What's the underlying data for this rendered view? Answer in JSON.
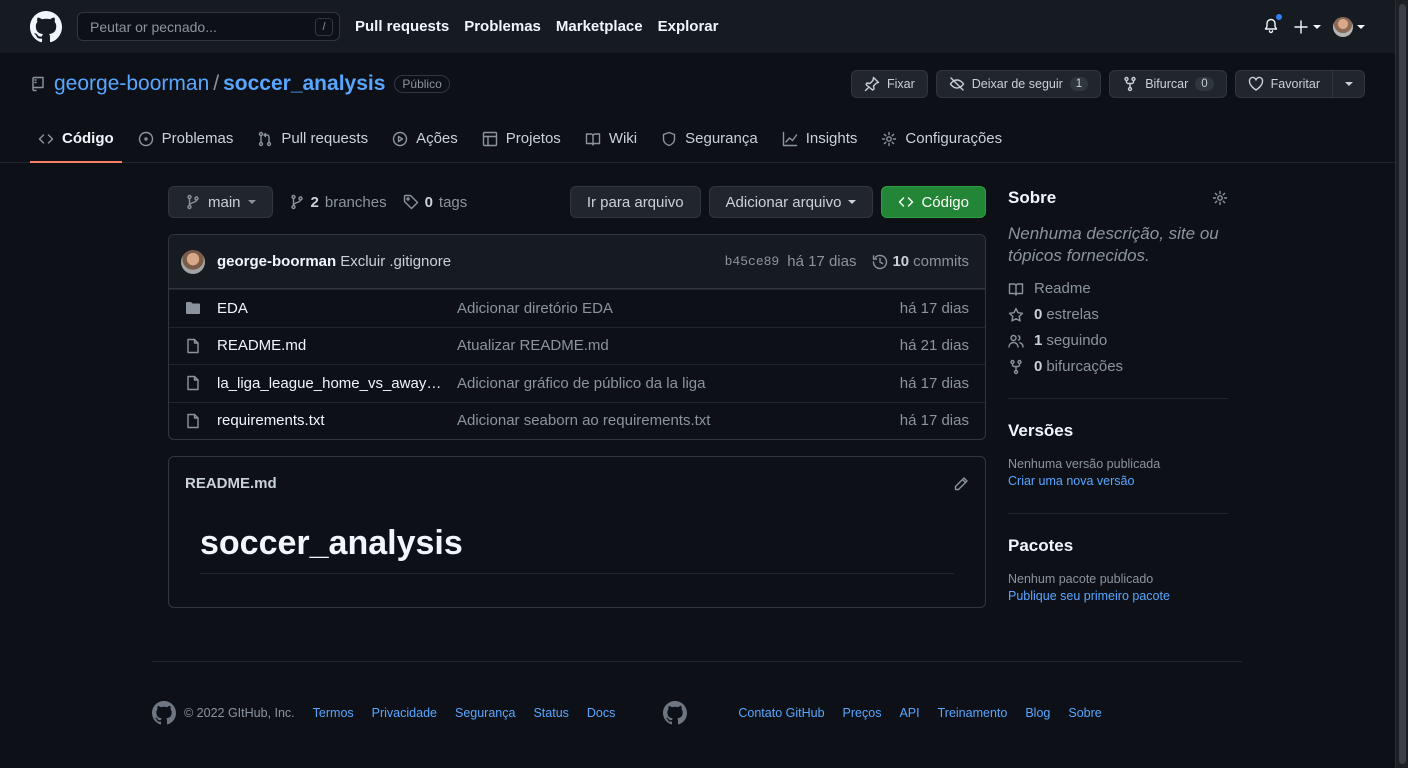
{
  "header": {
    "search_placeholder": "Peutar or pecnado...",
    "search_shortcut": "/",
    "nav": [
      "Pull requests",
      "Problemas",
      "Marketplace",
      "Explorar"
    ]
  },
  "repo": {
    "owner": "george-boorman",
    "separator": "/",
    "name": "soccer_analysis",
    "visibility": "Público",
    "actions": {
      "pin": "Fixar",
      "unwatch": "Deixar de seguir",
      "unwatch_count": "1",
      "fork": "Bifurcar",
      "fork_count": "0",
      "star": "Favoritar"
    }
  },
  "tabs": [
    "Código",
    "Problemas",
    "Pull requests",
    "Ações",
    "Projetos",
    "Wiki",
    "Segurança",
    "Insights",
    "Configurações"
  ],
  "toolbar": {
    "branch": "main",
    "branches_count": "2",
    "branches_label": "branches",
    "tags_count": "0",
    "tags_label": "tags",
    "go_to_file": "Ir para arquivo",
    "add_file": "Adicionar arquivo",
    "code": "Código"
  },
  "commit": {
    "author": "george-boorman",
    "message": "Excluir .gitignore",
    "sha": "b45ce89",
    "date": "há 17 dias",
    "commits_count": "10",
    "commits_label": "commits"
  },
  "files": [
    {
      "name": "EDA",
      "message": "Adicionar diretório EDA",
      "date": "há 17 dias",
      "type": "dir"
    },
    {
      "name": "README.md",
      "message": "Atualizar README.md",
      "date": "há 21 dias",
      "type": "file"
    },
    {
      "name": "la_liga_league_home_vs_away_att...",
      "message": "Adicionar gráfico de público da la liga",
      "date": "há 17 dias",
      "type": "file"
    },
    {
      "name": "requirements.txt",
      "message": "Adicionar seaborn ao requirements.txt",
      "date": "há 17 dias",
      "type": "file"
    }
  ],
  "readme": {
    "filename": "README.md",
    "heading": "soccer_analysis"
  },
  "sidebar": {
    "about_title": "Sobre",
    "about_desc": "Nenhuma descrição, site ou tópicos fornecidos.",
    "readme": "Readme",
    "stars_count": "0",
    "stars_label": "estrelas",
    "watching_count": "1",
    "watching_label": "seguindo",
    "forks_count": "0",
    "forks_label": "bifurcações",
    "releases_title": "Versões",
    "releases_none": "Nenhuma versão publicada",
    "releases_create": "Criar uma nova versão",
    "packages_title": "Pacotes",
    "packages_none": "Nenhum pacote publicado",
    "packages_publish": "Publique seu primeiro pacote"
  },
  "footer": {
    "copyright": "© 2022 GItHub, Inc.",
    "left_links": [
      "Termos",
      "Privacidade",
      "Segurança",
      "Status",
      "Docs"
    ],
    "right_links": [
      "Contato GitHub",
      "Preços",
      "API",
      "Treinamento",
      "Blog",
      "Sobre"
    ]
  },
  "colors": {
    "background": "#0d1117",
    "header": "#161b22",
    "link": "#58a6ff",
    "green_button": "#238636",
    "active_tab": "#f78166",
    "notification_dot": "#2f81f7"
  }
}
